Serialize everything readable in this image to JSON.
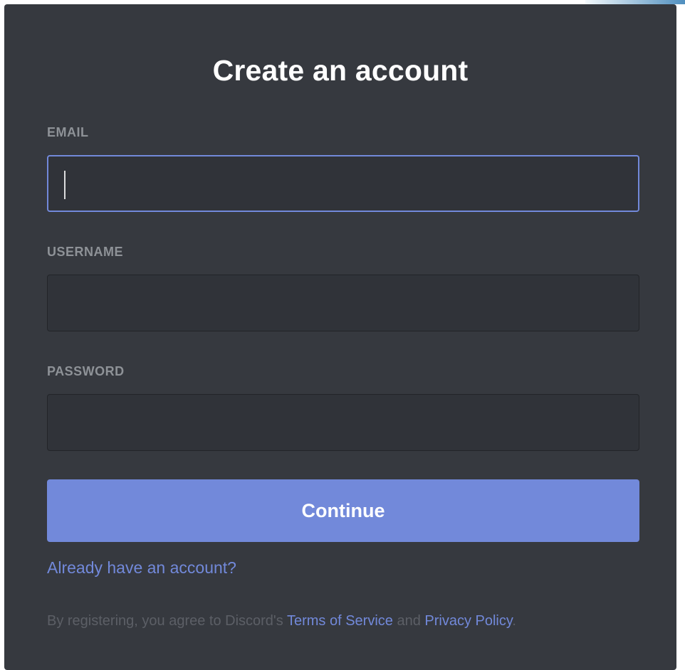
{
  "modal": {
    "title": "Create an account"
  },
  "form": {
    "email": {
      "label": "EMAIL",
      "value": "",
      "placeholder": ""
    },
    "username": {
      "label": "USERNAME",
      "value": "",
      "placeholder": ""
    },
    "password": {
      "label": "PASSWORD",
      "value": "",
      "placeholder": ""
    }
  },
  "actions": {
    "continue_label": "Continue",
    "login_link": "Already have an account?"
  },
  "terms": {
    "prefix": "By registering, you agree to Discord's ",
    "tos": "Terms of Service",
    "and": " and ",
    "privacy": "Privacy Policy",
    "suffix": "."
  },
  "colors": {
    "background": "#36393f",
    "input_background": "#303339",
    "accent": "#7289da",
    "label": "#8e9297",
    "muted_text": "#5c5f66"
  }
}
